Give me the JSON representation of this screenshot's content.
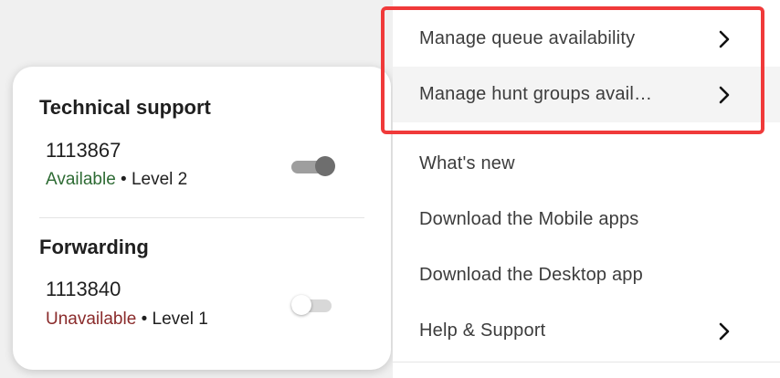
{
  "availability": {
    "groups": [
      {
        "title": "Technical support",
        "number": "1113867",
        "status": "Available",
        "separator": "•",
        "level": "Level 2",
        "toggle_on": true
      },
      {
        "title": "Forwarding",
        "number": "1113840",
        "status": "Unavailable",
        "separator": "•",
        "level": "Level 1",
        "toggle_on": false
      }
    ]
  },
  "menu": {
    "items": [
      {
        "label": "Manage queue availability",
        "has_submenu": true
      },
      {
        "label": "Manage hunt groups avail…",
        "has_submenu": true
      },
      {
        "label": "What's new",
        "has_submenu": false
      },
      {
        "label": "Download the Mobile apps",
        "has_submenu": false
      },
      {
        "label": "Download the Desktop app",
        "has_submenu": false
      },
      {
        "label": "Help & Support",
        "has_submenu": true
      }
    ]
  },
  "colors": {
    "highlight": "#f03a3a",
    "available": "#2e6b34",
    "unavailable": "#8a2b2b"
  }
}
